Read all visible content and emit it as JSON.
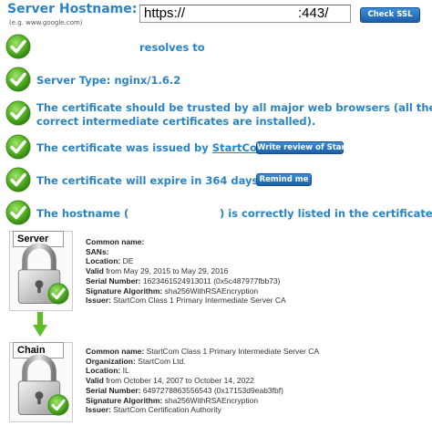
{
  "header": {
    "label": "Server Hostname:",
    "hint": "(e.g. www.google.com)",
    "input_prefix": "https://",
    "input_suffix": ":443/",
    "check_button": "Check SSL"
  },
  "results": {
    "resolves": "resolves to",
    "server_type": "Server Type: nginx/1.6.2",
    "trusted_line1": "The certificate should be trusted by all major web browsers (all the",
    "trusted_line2": "correct intermediate certificates are installed).",
    "issued_prefix": "The certificate was issued by ",
    "issued_link": "StartCom",
    "issued_suffix": ".",
    "review_button": "Write review of StartCom",
    "expire": "The certificate will expire in 364 days.",
    "remind_button": "Remind me",
    "hostname_prefix": "The hostname (",
    "hostname_suffix": ") is correctly listed in the certificate."
  },
  "server_cert": {
    "tag": "Server",
    "rows": [
      {
        "label": "Common name:",
        "value": ""
      },
      {
        "label": "SANs:",
        "value": ""
      },
      {
        "label": "Location:",
        "value": "DE"
      },
      {
        "label": "Valid",
        "value": "from May 29, 2015 to May 29, 2016"
      },
      {
        "label": "Serial Number:",
        "value": "1623461524913011 (0x5c487977fbb73)"
      },
      {
        "label": "Signature Algorithm:",
        "value": "sha256WithRSAEncryption"
      },
      {
        "label": "Issuer:",
        "value": "StartCom Class 1 Primary Intermediate Server CA"
      }
    ]
  },
  "chain_cert": {
    "tag": "Chain",
    "rows": [
      {
        "label": "Common name:",
        "value": "StartCom Class 1 Primary Intermediate Server CA"
      },
      {
        "label": "Organization:",
        "value": "StartCom Ltd."
      },
      {
        "label": "Location:",
        "value": "IL"
      },
      {
        "label": "Valid",
        "value": "from October 14, 2007 to October 14, 2022"
      },
      {
        "label": "Serial Number:",
        "value": "6497278863556543 (0x17153d9eab3fbf)"
      },
      {
        "label": "Signature Algorithm:",
        "value": "sha256WithRSAEncryption"
      },
      {
        "label": "Issuer:",
        "value": "StartCom Certification Authority"
      }
    ]
  },
  "colors": {
    "accent": "#2a83c4",
    "check_green": "#4fae1f",
    "button_blue": "#1c5fa8"
  },
  "icons": [
    "green-checkmark-icon",
    "padlock-icon",
    "down-arrow-icon"
  ]
}
